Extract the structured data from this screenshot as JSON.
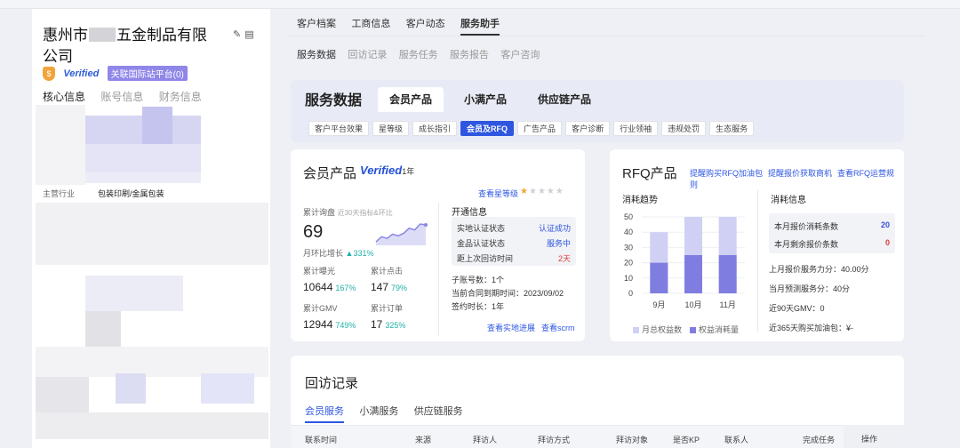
{
  "company": {
    "name_prefix": "惠州市",
    "name_suffix": "五金制品有限公司",
    "verified_label": "Verified",
    "intl_link": "关联国际站平台(0)",
    "tabs": [
      "核心信息",
      "账号信息",
      "财务信息"
    ],
    "main_business_label": "主营行业",
    "main_business_value": "包装印刷/金属包装"
  },
  "nav": {
    "primary": [
      "客户档案",
      "工商信息",
      "客户动态",
      "服务助手"
    ],
    "primary_active": 3,
    "secondary": [
      "服务数据",
      "回访记录",
      "服务任务",
      "服务报告",
      "客户咨询"
    ],
    "secondary_active": 0
  },
  "service": {
    "title": "服务数据",
    "product_tabs": [
      "会员产品",
      "小满产品",
      "供应链产品"
    ],
    "product_active": 0,
    "sub_tabs": [
      "客户平台效果",
      "星等级",
      "成长指引",
      "会员及RFQ",
      "广告产品",
      "客户诊断",
      "行业领袖",
      "违规处罚",
      "生态服务"
    ],
    "sub_active": 3
  },
  "member": {
    "title": "会员产品",
    "verified": "Verified",
    "years": "1年",
    "star_link": "查看星等级",
    "stars_on": 1,
    "stars_total": 5,
    "inquiry_label": "累计询盘",
    "inquiry_note": "近30天指标&环比",
    "inquiry_value": "69",
    "mom_label": "月环比增长",
    "mom_value": "331%",
    "trend": [
      6,
      12,
      10,
      15,
      13,
      16,
      22,
      20,
      27,
      26
    ],
    "stats": [
      {
        "label": "累计曝光",
        "value": "10644",
        "pct": "167%"
      },
      {
        "label": "累计点击",
        "value": "147",
        "pct": "79%"
      },
      {
        "label": "累计GMV",
        "value": "12944",
        "pct": "749%"
      },
      {
        "label": "累计订单",
        "value": "17",
        "pct": "325%"
      }
    ],
    "open_title": "开通信息",
    "open_rows": [
      {
        "label": "实地认证状态",
        "value": "认证成功"
      },
      {
        "label": "金品认证状态",
        "value": "服务中"
      },
      {
        "label": "距上次回访时间",
        "value": "2天"
      }
    ],
    "sub_accounts": "子账号数：1个",
    "contract_end": "当前合同到期时间：2023/09/02",
    "sign_duration": "签约时长：1年",
    "link_progress": "查看实地进展",
    "link_scrm": "查看scrm"
  },
  "rfq": {
    "title": "RFQ产品",
    "links": [
      "提醒购买RFQ加油包",
      "提醒报价获取商机",
      "查看RFQ运营规则"
    ],
    "trend_label": "消耗趋势",
    "info_label": "消耗信息",
    "chart_data": {
      "type": "bar",
      "categories": [
        "9月",
        "10月",
        "11月"
      ],
      "series": [
        {
          "name": "月总权益数",
          "values": [
            40,
            50,
            50
          ]
        },
        {
          "name": "权益消耗量",
          "values": [
            20,
            25,
            25
          ]
        }
      ],
      "ylim": [
        0,
        50
      ],
      "yticks": [
        0,
        10,
        20,
        30,
        40,
        50
      ],
      "colors": [
        "#cfd0f3",
        "#7f7ee0"
      ]
    },
    "info_rows": [
      {
        "label": "本月报价消耗条数",
        "value": "20",
        "color": "#3a4fd6"
      },
      {
        "label": "本月剩余报价条数",
        "value": "0",
        "color": "#e23b3b"
      }
    ],
    "lines": [
      "上月报价服务力分：40.00分",
      "当月预测服务分：40分",
      "近90天GMV：0",
      "近365天购买加油包：¥-"
    ]
  },
  "visit": {
    "title": "回访记录",
    "tabs": [
      "会员服务",
      "小满服务",
      "供应链服务"
    ],
    "tab_active": 0,
    "columns": [
      "联系时间",
      "来源",
      "拜访人",
      "拜访方式",
      "拜访对象",
      "是否KP",
      "联系人",
      "完成任务",
      "操作"
    ]
  }
}
